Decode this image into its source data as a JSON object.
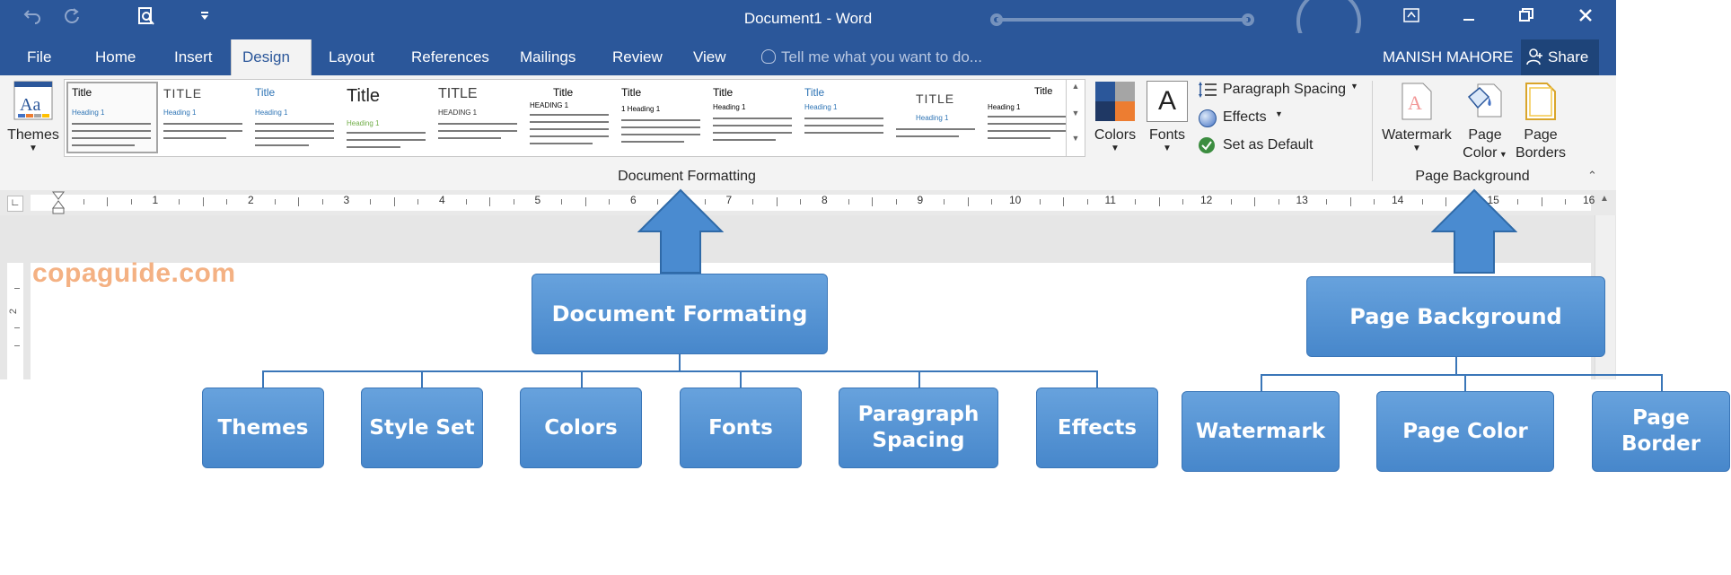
{
  "window": {
    "title": "Document1 - Word",
    "controls": [
      "minimize",
      "restore",
      "close"
    ]
  },
  "tabs": [
    "File",
    "Home",
    "Insert",
    "Design",
    "Layout",
    "References",
    "Mailings",
    "Review",
    "View"
  ],
  "active_tab": "Design",
  "tell_me": "Tell me what you want to do...",
  "user": "MANISH MAHORE",
  "share": "Share",
  "ribbon": {
    "themes": "Themes",
    "style_titles": [
      "Title",
      "TITLE",
      "Title",
      "Title",
      "TITLE",
      "Title",
      "Title",
      "Title",
      "Title",
      "TITLE",
      "Title"
    ],
    "style_heads": [
      "Heading 1",
      "Heading 1",
      "Heading 1",
      "Heading 1",
      "HEADING 1",
      "HEADING 1",
      "1  Heading 1",
      "Heading 1",
      "Heading 1",
      "Heading 1",
      "Heading 1"
    ],
    "colors": "Colors",
    "fonts": "Fonts",
    "fonts_glyph": "A",
    "paragraph_spacing": "Paragraph Spacing",
    "effects": "Effects",
    "set_as_default": "Set as Default",
    "group_document_formatting": "Document Formatting",
    "watermark": "Watermark",
    "page_color_1": "Page",
    "page_color_2": "Color",
    "page_borders_1": "Page",
    "page_borders_2": "Borders",
    "group_page_background": "Page Background"
  },
  "ruler_numbers": [
    "1",
    "2",
    "3",
    "4",
    "5",
    "6",
    "7",
    "8",
    "9",
    "10",
    "11",
    "12",
    "13",
    "14",
    "15",
    "16"
  ],
  "watermark_text": "copaguide.com",
  "diagram": {
    "document_formatting": "Document Formating",
    "page_background": "Page Background",
    "doc_children": [
      "Themes",
      "Style Set",
      "Colors",
      "Fonts",
      "Paragraph Spacing",
      "Effects"
    ],
    "page_children": [
      "Watermark",
      "Page Color",
      "Page Border"
    ]
  },
  "colors": {
    "word_blue": "#2b579a",
    "box_blue": "#4a8bd0",
    "watermark_orange": "#f4b183"
  }
}
